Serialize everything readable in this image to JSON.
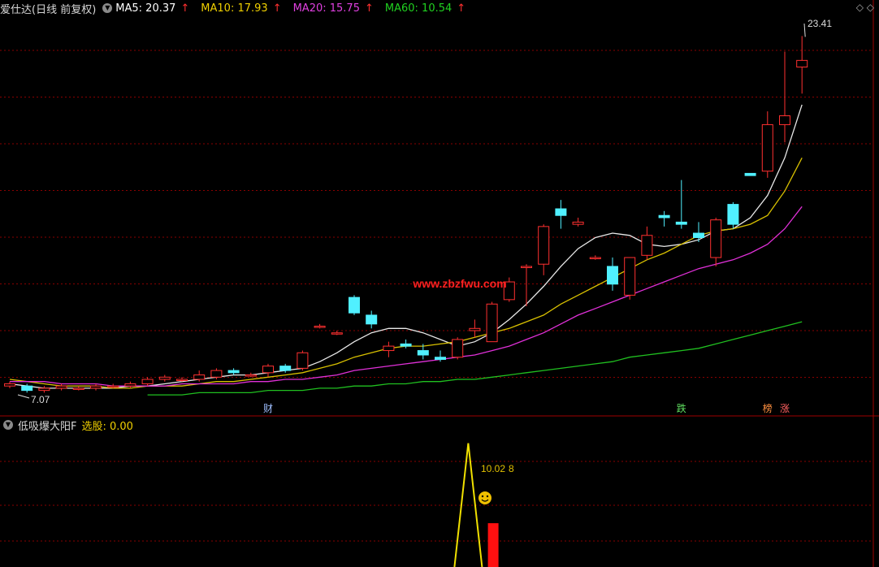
{
  "header": {
    "stock_title": "爱仕达(日线 前复权)",
    "ma_items": [
      {
        "label": "MA5: 20.37",
        "arrow": "↑",
        "color": "#ffffff"
      },
      {
        "label": "MA10: 17.93",
        "arrow": "↑",
        "color": "#f0d000"
      },
      {
        "label": "MA20: 15.75",
        "arrow": "↑",
        "color": "#e040e0"
      },
      {
        "label": "MA60: 10.54",
        "arrow": "↑",
        "color": "#20d020"
      }
    ],
    "corner_icons": "◇  ◇"
  },
  "sub_header": {
    "indicator_name": "低吸爆大阳F",
    "select_label": "选股: 0.00"
  },
  "watermark": "www.zbzfwu.com",
  "markers": [
    {
      "text": "财",
      "color": "#9fbfff",
      "index": 15
    },
    {
      "text": "跌",
      "color": "#60e060",
      "index": 39
    },
    {
      "text": "榜",
      "color": "#ff9040",
      "index": 44
    },
    {
      "text": "涨",
      "color": "#ff6060",
      "index": 45
    }
  ],
  "chart_data": {
    "type": "candlestick",
    "price_labels": {
      "high": "23.41",
      "low": "7.07"
    },
    "ylim": [
      6.8,
      24.0
    ],
    "candles": [
      [
        7.6,
        7.8,
        7.5,
        7.7
      ],
      [
        7.6,
        7.7,
        7.3,
        7.4
      ],
      [
        7.4,
        7.6,
        7.3,
        7.5
      ],
      [
        7.5,
        7.7,
        7.4,
        7.6
      ],
      [
        7.5,
        7.6,
        7.4,
        7.5
      ],
      [
        7.5,
        7.7,
        7.4,
        7.6
      ],
      [
        7.6,
        7.7,
        7.5,
        7.6
      ],
      [
        7.6,
        7.8,
        7.5,
        7.7
      ],
      [
        7.7,
        8.0,
        7.6,
        7.9
      ],
      [
        7.9,
        8.1,
        7.8,
        8.0
      ],
      [
        7.9,
        8.0,
        7.8,
        7.9
      ],
      [
        7.9,
        8.3,
        7.8,
        8.1
      ],
      [
        8.0,
        8.4,
        7.9,
        8.3
      ],
      [
        8.3,
        8.4,
        8.1,
        8.2
      ],
      [
        8.1,
        8.2,
        8.0,
        8.1
      ],
      [
        8.2,
        8.6,
        8.0,
        8.5
      ],
      [
        8.5,
        8.6,
        8.2,
        8.3
      ],
      [
        8.4,
        9.2,
        8.3,
        9.1
      ],
      [
        10.3,
        10.4,
        10.2,
        10.3
      ],
      [
        10.0,
        10.1,
        9.9,
        10.0
      ],
      [
        11.6,
        11.7,
        10.8,
        10.9
      ],
      [
        10.8,
        11.0,
        10.2,
        10.4
      ],
      [
        9.2,
        9.6,
        8.9,
        9.4
      ],
      [
        9.5,
        9.7,
        9.3,
        9.4
      ],
      [
        9.2,
        9.5,
        8.8,
        9.0
      ],
      [
        8.9,
        9.2,
        8.7,
        8.8
      ],
      [
        8.9,
        9.8,
        8.8,
        9.7
      ],
      [
        10.1,
        10.6,
        9.8,
        10.2
      ],
      [
        9.6,
        11.4,
        9.6,
        11.3
      ],
      [
        11.5,
        12.5,
        11.4,
        12.3
      ],
      [
        13.0,
        13.1,
        11.2,
        13.0
      ],
      [
        13.1,
        14.9,
        12.6,
        14.8
      ],
      [
        15.6,
        16.0,
        14.7,
        15.3
      ],
      [
        14.9,
        15.2,
        14.8,
        15.0
      ],
      [
        13.4,
        13.5,
        13.3,
        13.4
      ],
      [
        13.0,
        13.4,
        11.9,
        12.2
      ],
      [
        11.7,
        13.4,
        11.5,
        13.4
      ],
      [
        13.5,
        14.8,
        13.3,
        14.4
      ],
      [
        15.3,
        15.5,
        14.8,
        15.2
      ],
      [
        15.0,
        16.9,
        14.7,
        14.9
      ],
      [
        14.5,
        15.0,
        14.1,
        14.3
      ],
      [
        13.4,
        15.2,
        13.0,
        15.1
      ],
      [
        15.8,
        15.9,
        14.7,
        14.9
      ],
      [
        17.2,
        17.2,
        17.1,
        17.1
      ],
      [
        17.3,
        20.0,
        17.0,
        19.4
      ],
      [
        19.4,
        22.7,
        18.6,
        19.8
      ],
      [
        22.0,
        23.4,
        20.8,
        22.3
      ]
    ],
    "ma": {
      "ma5": [
        7.7,
        7.6,
        7.5,
        7.5,
        7.5,
        7.5,
        7.5,
        7.6,
        7.6,
        7.7,
        7.8,
        7.9,
        8.0,
        8.1,
        8.1,
        8.2,
        8.3,
        8.4,
        8.7,
        9.1,
        9.6,
        10.0,
        10.2,
        10.2,
        10.0,
        9.7,
        9.4,
        9.6,
        10.0,
        10.6,
        11.3,
        12.1,
        13.0,
        13.8,
        14.3,
        14.5,
        14.4,
        14.0,
        13.9,
        14.0,
        14.2,
        14.6,
        14.7,
        15.2,
        16.2,
        17.9,
        20.3
      ],
      "ma10": [
        7.9,
        7.8,
        7.7,
        7.6,
        7.6,
        7.6,
        7.5,
        7.5,
        7.6,
        7.6,
        7.6,
        7.7,
        7.8,
        7.8,
        7.9,
        8.0,
        8.1,
        8.2,
        8.4,
        8.6,
        8.9,
        9.1,
        9.3,
        9.4,
        9.4,
        9.5,
        9.6,
        9.8,
        10.0,
        10.2,
        10.5,
        10.8,
        11.3,
        11.7,
        12.1,
        12.5,
        12.9,
        13.3,
        13.6,
        14.0,
        14.4,
        14.6,
        14.7,
        14.9,
        15.3,
        16.4,
        17.9
      ],
      "ma20": [
        7.8,
        7.8,
        7.8,
        7.7,
        7.7,
        7.7,
        7.6,
        7.6,
        7.6,
        7.6,
        7.7,
        7.7,
        7.7,
        7.7,
        7.8,
        7.8,
        7.9,
        7.9,
        8.0,
        8.1,
        8.3,
        8.4,
        8.5,
        8.6,
        8.7,
        8.8,
        8.9,
        9.0,
        9.2,
        9.4,
        9.7,
        10.0,
        10.4,
        10.8,
        11.1,
        11.4,
        11.7,
        12.0,
        12.3,
        12.6,
        12.9,
        13.1,
        13.3,
        13.6,
        14.0,
        14.7,
        15.7
      ],
      "ma60": [
        null,
        null,
        null,
        null,
        null,
        null,
        null,
        null,
        7.2,
        7.2,
        7.2,
        7.3,
        7.3,
        7.3,
        7.3,
        7.4,
        7.4,
        7.4,
        7.5,
        7.5,
        7.6,
        7.6,
        7.7,
        7.7,
        7.8,
        7.8,
        7.9,
        7.9,
        8.0,
        8.1,
        8.2,
        8.3,
        8.4,
        8.5,
        8.6,
        8.7,
        8.9,
        9.0,
        9.1,
        9.2,
        9.3,
        9.5,
        9.7,
        9.9,
        10.1,
        10.3,
        10.5
      ]
    },
    "sub_chart": {
      "ylim": [
        0,
        12
      ],
      "signal_label": "10.02",
      "signal_label_tail": "8",
      "spike": {
        "index": 27,
        "value": 11.0
      },
      "bar": {
        "index": 28,
        "value": 3.8
      }
    }
  }
}
